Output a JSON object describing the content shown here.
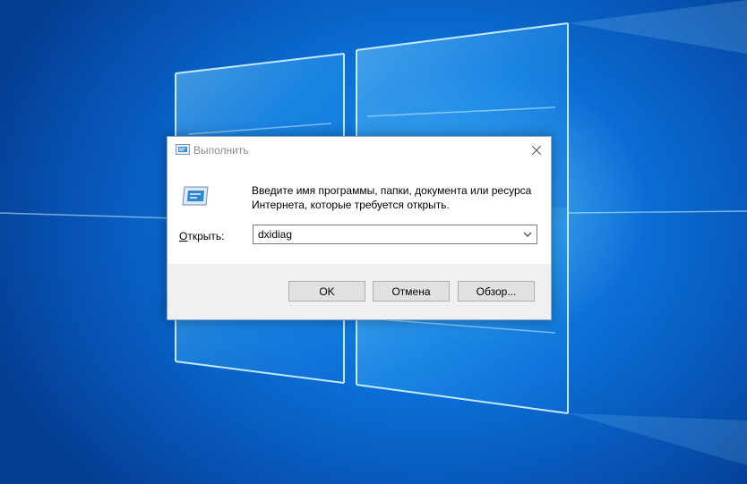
{
  "dialog": {
    "title": "Выполнить",
    "prompt_line1": "Введите имя программы, папки, документа или ресурса",
    "prompt_line2": "Интернета, которые требуется открыть.",
    "open_label": "Открыть:",
    "open_label_access_key": "О",
    "open_label_rest": "ткрыть:",
    "command_value": "dxidiag",
    "buttons": {
      "ok": "OK",
      "cancel": "Отмена",
      "browse": "Обзор..."
    }
  },
  "icons": {
    "title": "run-icon",
    "app": "run-app-icon",
    "close": "close-icon",
    "dropdown": "chevron-down-icon"
  },
  "colors": {
    "desktop_blue": "#0b6fd6",
    "window_light": "#9fe4ff",
    "dialog_background": "#ffffff",
    "button_bar": "#f0f0f0",
    "button_face": "#e1e1e1",
    "title_text": "#8a8a8a"
  }
}
